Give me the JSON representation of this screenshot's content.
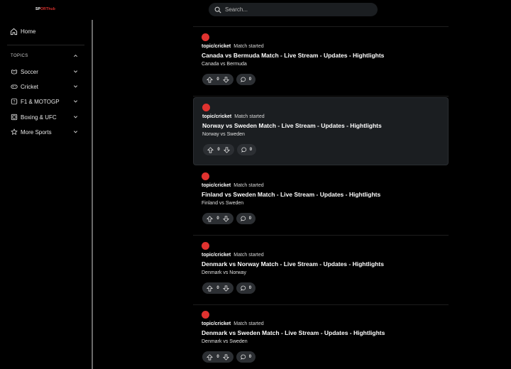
{
  "logo": {
    "part1": "SP",
    "part2": "ORT",
    "part3": "hub"
  },
  "search": {
    "placeholder": "Search...",
    "icon": "search-icon"
  },
  "sidebar": {
    "home_label": "Home",
    "topics_label": "TOPICS",
    "topics": [
      {
        "label": "Soccer",
        "icon": "soccer-icon"
      },
      {
        "label": "Cricket",
        "icon": "gamepad-icon"
      },
      {
        "label": "F1 & MOTOGP",
        "icon": "helmet-icon"
      },
      {
        "label": "Boxing & UFC",
        "icon": "boxing-icon"
      },
      {
        "label": "More Sports",
        "icon": "trophy-icon"
      }
    ]
  },
  "colors": {
    "accent": "#e0322f",
    "card_highlight": "#1b1e21",
    "chip": "#2c2f33"
  },
  "posts": [
    {
      "topic": "topic/cricket",
      "status": "Match started",
      "title": "Canada vs Bermuda Match - Live Stream - Updates - Hightlights",
      "subtitle": "Canada vs Bermuda",
      "votes": "0",
      "comments": "0"
    },
    {
      "topic": "topic/cricket",
      "status": "Match started",
      "title": "Norway vs Sweden Match - Live Stream - Updates - Hightlights",
      "subtitle": "Norway vs Sweden",
      "votes": "0",
      "comments": "0"
    },
    {
      "topic": "topic/cricket",
      "status": "Match started",
      "title": "Finland vs Sweden Match - Live Stream - Updates - Hightlights",
      "subtitle": "Finland vs Sweden",
      "votes": "0",
      "comments": "0"
    },
    {
      "topic": "topic/cricket",
      "status": "Match started",
      "title": "Denmark vs Norway Match - Live Stream - Updates - Hightlights",
      "subtitle": "Denmark vs Norway",
      "votes": "0",
      "comments": "0"
    },
    {
      "topic": "topic/cricket",
      "status": "Match started",
      "title": "Denmark vs Sweden Match - Live Stream - Updates - Hightlights",
      "subtitle": "Denmark vs Sweden",
      "votes": "0",
      "comments": "0"
    }
  ]
}
